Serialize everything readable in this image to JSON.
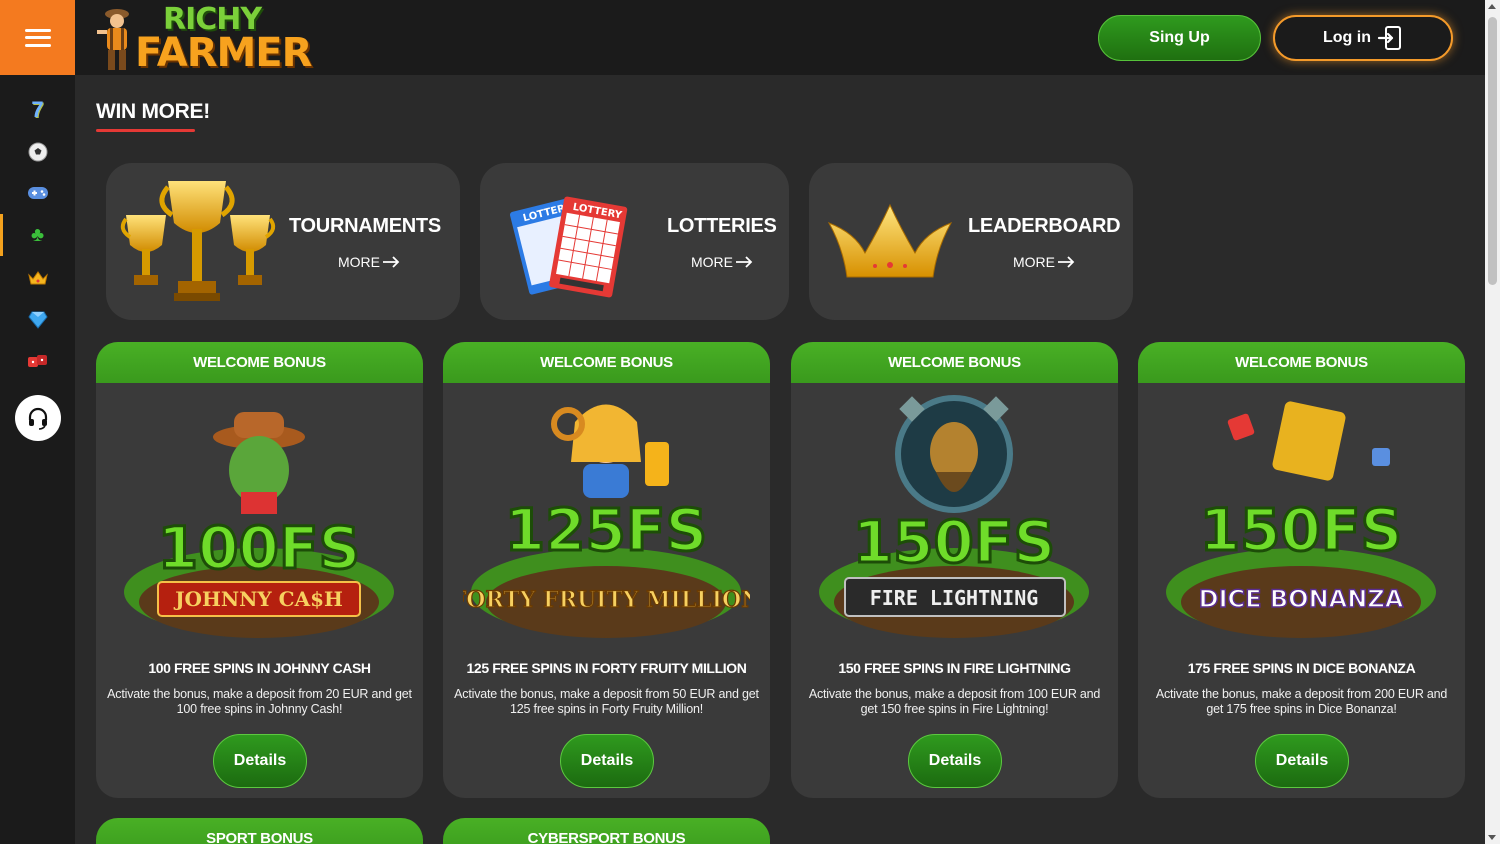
{
  "brand": {
    "word1": "RICHY",
    "word2": "FARMER"
  },
  "header": {
    "signup_label": "Sing Up",
    "login_label": "Log in"
  },
  "sidebar": {
    "items": [
      {
        "icon": "slot-seven-icon"
      },
      {
        "icon": "soccer-ball-icon"
      },
      {
        "icon": "gamepad-icon"
      },
      {
        "icon": "clover-icon",
        "active": true
      },
      {
        "icon": "crown-icon"
      },
      {
        "icon": "diamond-icon"
      },
      {
        "icon": "dice-icon"
      }
    ],
    "support_icon": "headset-icon"
  },
  "section": {
    "title": "WIN MORE!"
  },
  "promos": [
    {
      "title": "TOURNAMENTS",
      "more": "MORE",
      "icon": "trophies-icon"
    },
    {
      "title": "LOTTERIES",
      "more": "MORE",
      "icon": "lottery-tickets-icon"
    },
    {
      "title": "LEADERBOARD",
      "more": "MORE",
      "icon": "crown-icon"
    }
  ],
  "bonuses": [
    {
      "band": "WELCOME BONUS",
      "big": "100FS",
      "game_logo": "JOHNNY CA$H",
      "title": "100 FREE SPINS IN JOHNNY CASH",
      "desc": "Activate the bonus, make a deposit from 20 EUR and get 100 free spins in Johnny Cash!",
      "button": "Details"
    },
    {
      "band": "WELCOME BONUS",
      "big": "125FS",
      "game_logo": "FORTY FRUITY MILLION",
      "title": "125 FREE SPINS IN FORTY FRUITY MILLION",
      "desc": "Activate the bonus, make a deposit from 50 EUR and get 125 free spins in Forty Fruity Million!",
      "button": "Details"
    },
    {
      "band": "WELCOME BONUS",
      "big": "150FS",
      "game_logo": "FIRE LIGHTNING",
      "title": "150 FREE SPINS IN FIRE LIGHTNING",
      "desc": "Activate the bonus, make a deposit from 100 EUR and get 150 free spins in Fire Lightning!",
      "button": "Details"
    },
    {
      "band": "WELCOME BONUS",
      "big": "150FS",
      "game_logo": "DICE BONANZA",
      "title": "175 FREE SPINS IN DICE BONANZA",
      "desc": "Activate the bonus, make a deposit from 200 EUR and get 175 free spins in Dice Bonanza!",
      "button": "Details"
    }
  ],
  "next_row": [
    {
      "band": "SPORT BONUS"
    },
    {
      "band": "CYBERSPORT BONUS"
    }
  ],
  "colors": {
    "accent_orange": "#f47a1f",
    "green": "#3a9a1d",
    "underline_red": "#e53935"
  }
}
